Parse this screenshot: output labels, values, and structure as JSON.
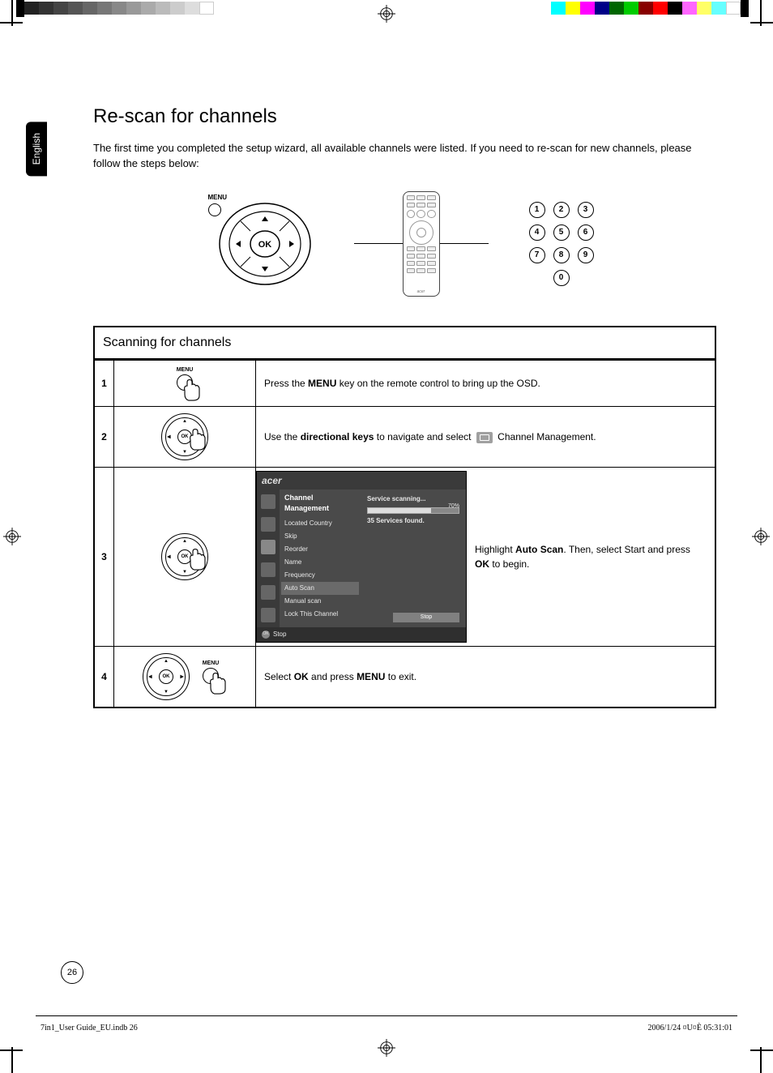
{
  "lang_tab": "English",
  "title": "Re-scan for channels",
  "intro": "The first time you completed the setup wizard, all available channels were listed. If you need to re-scan for new channels, please follow the steps below:",
  "diagram": {
    "menu_label": "MENU",
    "ok_label": "OK",
    "keypad": [
      "1",
      "2",
      "3",
      "4",
      "5",
      "6",
      "7",
      "8",
      "9",
      "0"
    ],
    "remote_brand": "acer"
  },
  "table": {
    "header": "Scanning for channels",
    "rows": [
      {
        "num": "1",
        "img_label": "MENU",
        "desc_pre": "Press the ",
        "desc_b1": "MENU",
        "desc_post": " key on the remote control to bring up the OSD."
      },
      {
        "num": "2",
        "ok_label": "OK",
        "desc_pre": "Use the ",
        "desc_b1": "directional keys",
        "desc_mid": " to navigate and select ",
        "desc_post": " Channel Management."
      },
      {
        "num": "3",
        "ok_label": "OK",
        "osd": {
          "logo": "acer",
          "heading": "Channel Management",
          "items": [
            "Located Country",
            "Skip",
            "Reorder",
            "Name",
            "Frequency",
            "Auto Scan",
            "Manual scan",
            "Lock This Channel"
          ],
          "selected": "Auto Scan",
          "service_scanning": "Service scanning...",
          "percent": "70%",
          "found": "35 Services found.",
          "stop": "Stop",
          "ok": "OK",
          "foot_stop": "Stop"
        },
        "desc_pre": "Highlight ",
        "desc_b1": "Auto Scan",
        "desc_mid": ". Then, select Start and press ",
        "desc_b2": "OK",
        "desc_post": " to begin."
      },
      {
        "num": "4",
        "ok_label": "OK",
        "img_label": "MENU",
        "desc_pre": "Select ",
        "desc_b1": "OK",
        "desc_mid": " and press ",
        "desc_b2": "MENU",
        "desc_post": " to exit."
      }
    ]
  },
  "page_number": "26",
  "footer": {
    "left": "7in1_User Guide_EU.indb   26",
    "right": "2006/1/24   ¤U¤È 05:31:01"
  }
}
